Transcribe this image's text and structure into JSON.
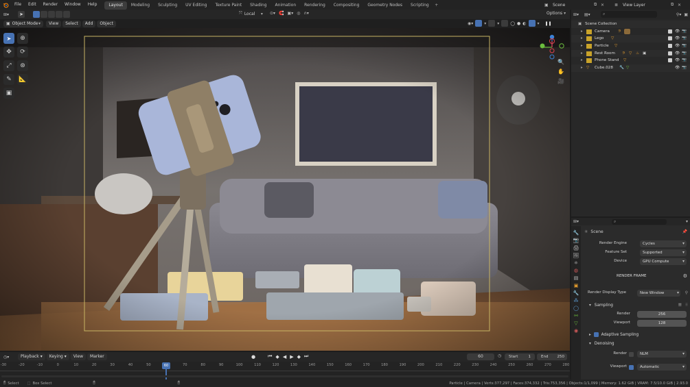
{
  "topbar": {
    "menus": [
      "File",
      "Edit",
      "Render",
      "Window",
      "Help"
    ],
    "workspaces": [
      "Layout",
      "Modeling",
      "Sculpting",
      "UV Editing",
      "Texture Paint",
      "Shading",
      "Animation",
      "Rendering",
      "Compositing",
      "Geometry Nodes",
      "Scripting"
    ],
    "active_workspace": "Layout",
    "scene_label": "Scene",
    "view_layer_label": "View Layer"
  },
  "viewport_header": {
    "transform_orientation": "Local",
    "options_label": "Options"
  },
  "viewport_header2": {
    "mode": "Object Mode",
    "menus": [
      "View",
      "Select",
      "Add",
      "Object"
    ]
  },
  "outliner": {
    "search_placeholder": "",
    "root": "Scene Collection",
    "items": [
      {
        "name": "Camera"
      },
      {
        "name": "Lego"
      },
      {
        "name": "Particle"
      },
      {
        "name": "Rest Room"
      },
      {
        "name": "Phone Stand"
      },
      {
        "name": "Cube.028"
      }
    ]
  },
  "properties": {
    "scene_label": "Scene",
    "render_engine_label": "Render Engine",
    "render_engine_value": "Cycles",
    "feature_set_label": "Feature Set",
    "feature_set_value": "Supported",
    "device_label": "Device",
    "device_value": "GPU Compute",
    "render_frame_label": "RENDER FRAME",
    "display_type_label": "Render Display Type",
    "display_type_value": "New Window",
    "sampling_label": "Sampling",
    "render_label": "Render",
    "render_samples": "256",
    "viewport_label": "Viewport",
    "viewport_samples": "128",
    "adaptive_label": "Adaptive Sampling",
    "denoising_label": "Denoising",
    "denoise_render_label": "Render",
    "denoise_render_value": "NLM",
    "denoise_viewport_label": "Viewport",
    "denoise_viewport_value": "Automatic"
  },
  "timeline": {
    "menus": [
      "Playback",
      "Keying",
      "View",
      "Marker"
    ],
    "current_frame": "60",
    "start_label": "Start",
    "start_value": "1",
    "end_label": "End",
    "end_value": "250",
    "ticks": [
      "-30",
      "-20",
      "-10",
      "0",
      "10",
      "20",
      "30",
      "40",
      "50",
      "60",
      "70",
      "80",
      "90",
      "100",
      "110",
      "120",
      "130",
      "140",
      "150",
      "160",
      "170",
      "180",
      "190",
      "200",
      "210",
      "220",
      "230",
      "240",
      "250",
      "260",
      "270",
      "280"
    ],
    "playhead_label": "60"
  },
  "statusbar": {
    "select_label": "Select",
    "box_select_label": "Box Select",
    "stats": "Particle | Camera | Verts:377,297 | Faces:374,332 | Tris:753,356 | Objects:1/1,099 | Memory: 1.62 GiB | VRAM: 7.5/10.0 GiB | 2.93.0"
  },
  "colors": {
    "accent": "#4772b3",
    "camera_frame": "#c8b464",
    "axis_x": "#e0414f",
    "axis_y": "#6cbd3e",
    "axis_z": "#3c82d6"
  }
}
